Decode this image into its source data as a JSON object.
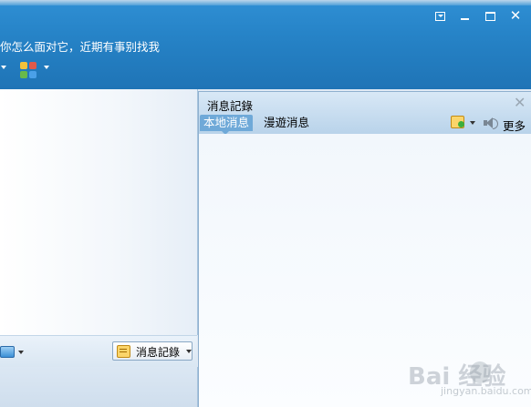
{
  "window": {
    "signature": "你怎么面对它，近期有事别找我",
    "controls": {
      "close": "✕"
    }
  },
  "chat": {
    "history_button_label": "消息記錄"
  },
  "history_panel": {
    "title": "消息記錄",
    "close": "✕",
    "tabs": [
      {
        "label": "本地消息",
        "active": true
      },
      {
        "label": "漫遊消息",
        "active": false
      }
    ],
    "more_label": "更多"
  },
  "watermark": {
    "brand": "Bai 经验",
    "sub": "jingyan.baidu.com"
  },
  "colors": {
    "titlebar": "#2683c7",
    "active_tab": "#6fa9d8",
    "panel_border": "#8fb0cf"
  }
}
